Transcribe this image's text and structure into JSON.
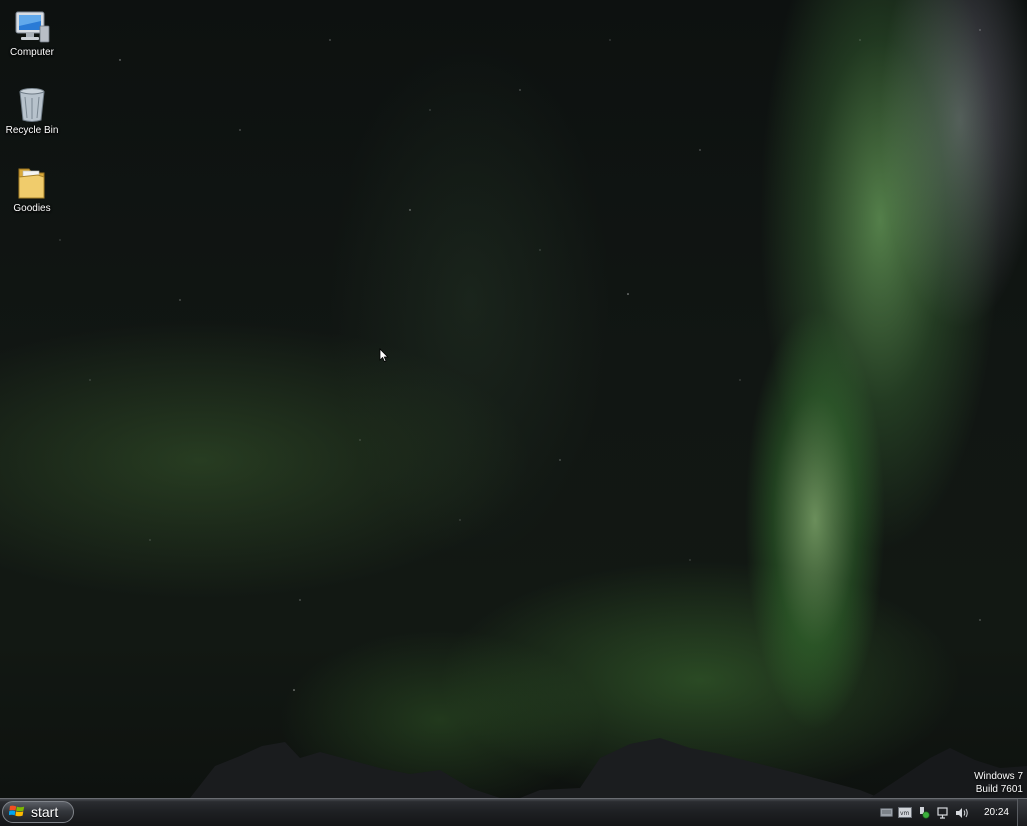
{
  "desktop": {
    "icons": [
      {
        "label": "Computer",
        "icon": "computer-icon"
      },
      {
        "label": "Recycle Bin",
        "icon": "recycle-bin-icon"
      },
      {
        "label": "Goodies",
        "icon": "folder-icon"
      }
    ],
    "watermark": {
      "line1": "Windows 7",
      "line2": "Build 7601"
    },
    "wallpaper": "aurora-borealis"
  },
  "taskbar": {
    "start_label": "start",
    "start_icon": "windows-logo-icon",
    "tray_icons": [
      "keyboard-icon",
      "vm-tools-icon",
      "security-shield-icon",
      "network-icon",
      "volume-icon"
    ],
    "clock": "20:24"
  },
  "colors": {
    "aurora_green": "#6fcf5a",
    "taskbar_dark": "#1d1f22",
    "label_text": "#ffffff"
  }
}
